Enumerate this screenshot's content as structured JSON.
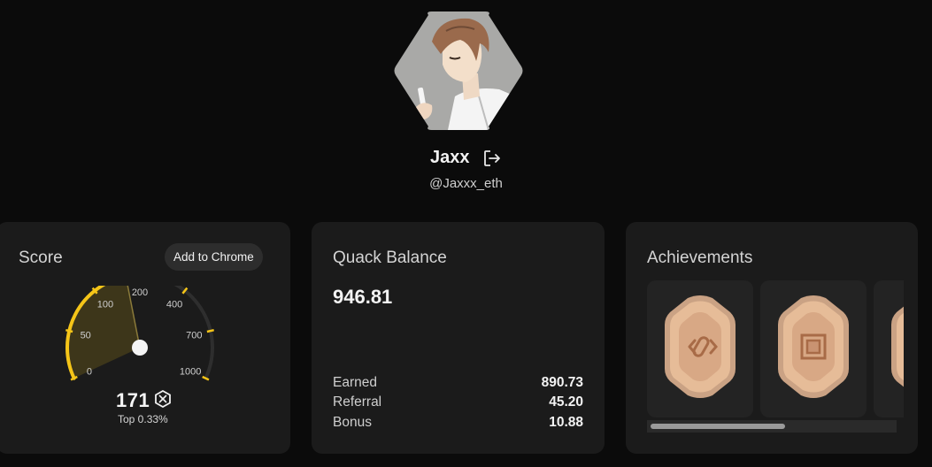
{
  "profile": {
    "name": "Jaxx",
    "handle": "@Jaxxx_eth",
    "avatar": "anime-boy-avatar"
  },
  "score_card": {
    "title": "Score",
    "add_to_chrome_label": "Add to Chrome",
    "value": "171",
    "rank": "Top 0.33%",
    "gauge": {
      "tick_labels": [
        "0",
        "50",
        "100",
        "200",
        "400",
        "700",
        "1000"
      ],
      "current_score": 171,
      "accent_color": "#f5c518"
    }
  },
  "balance_card": {
    "title": "Quack Balance",
    "total": "946.81",
    "rows": [
      {
        "label": "Earned",
        "value": "890.73"
      },
      {
        "label": "Referral",
        "value": "45.20"
      },
      {
        "label": "Bonus",
        "value": "10.88"
      }
    ]
  },
  "achievements_card": {
    "title": "Achievements",
    "badges": [
      {
        "icon": "chain-link-badge-icon"
      },
      {
        "icon": "square-frame-badge-icon"
      },
      {
        "icon": "badge-icon"
      }
    ],
    "badge_color": "#e0b08b"
  }
}
